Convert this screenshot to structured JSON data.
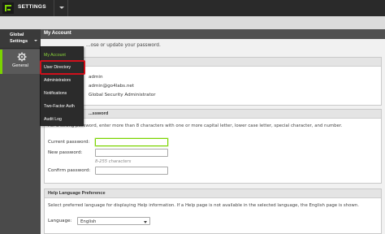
{
  "app": {
    "title": "SETTINGS"
  },
  "sidebar": {
    "header_line1": "Global",
    "header_line2": "Settings",
    "general_label": "General"
  },
  "menu": {
    "items": [
      {
        "label": "My Account"
      },
      {
        "label": "User Directory"
      },
      {
        "label": "Administrators"
      },
      {
        "label": "Notifications"
      },
      {
        "label": "Two-Factor Auth"
      },
      {
        "label": "Audit Log"
      }
    ]
  },
  "main": {
    "page_title": "My Account",
    "intro": "...ose or update your password.",
    "account": {
      "username": "admin",
      "email": "admin@go4labs.net",
      "role": "Global Security Administrator"
    },
    "password": {
      "title": "...ssword",
      "note": "For a strong password, enter more than 8 characters with one or more capital letter, lower case letter, special character, and number.",
      "current_label": "Current password:",
      "new_label": "New password:",
      "length_hint": "8-255 characters",
      "confirm_label": "Confirm password:"
    },
    "help_language": {
      "title": "Help Language Preference",
      "note": "Select preferred language for displaying Help information. If a Help page is not available in the selected language, the English page is shown.",
      "language_label": "Language:",
      "language_value": "English"
    }
  },
  "colors": {
    "accent": "#7bd400",
    "highlight": "#d0101b"
  }
}
